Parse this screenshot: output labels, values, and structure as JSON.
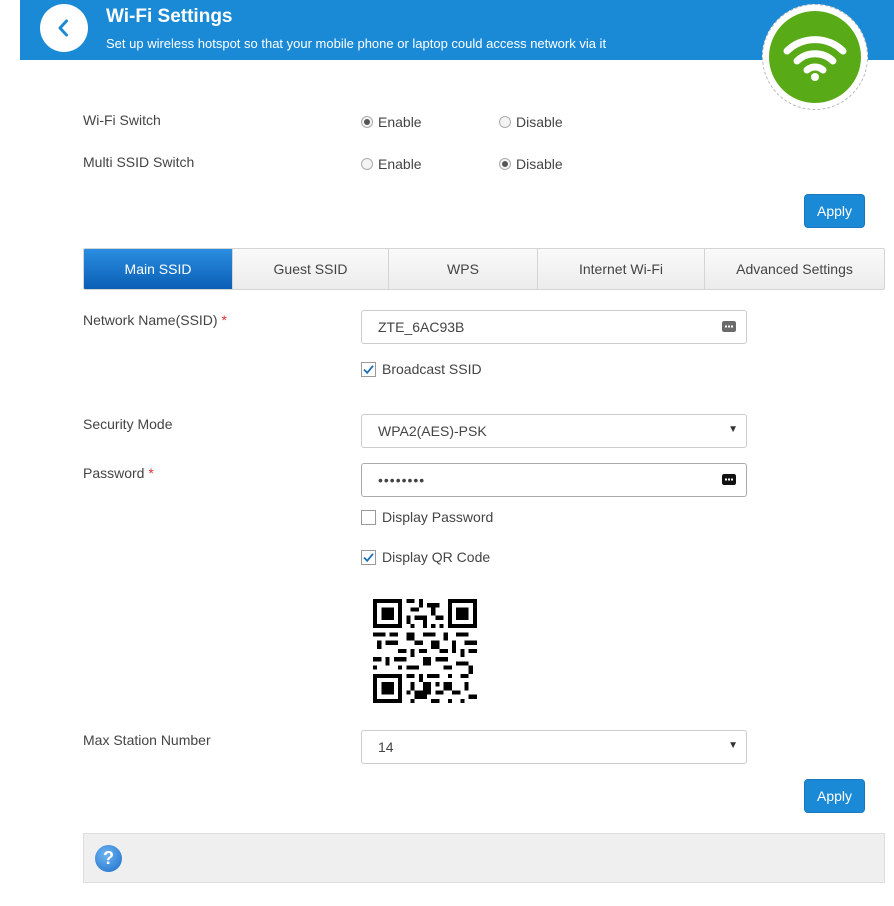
{
  "header": {
    "title": "Wi-Fi Settings",
    "subtitle": "Set up wireless hotspot so that your mobile phone or laptop could access network via it",
    "back_icon": "chevron-left-icon",
    "badge_icon": "wifi-icon"
  },
  "switches": {
    "wifi_switch": {
      "label": "Wi-Fi Switch",
      "enable": "Enable",
      "disable": "Disable",
      "selected": "Enable"
    },
    "multi_ssid_switch": {
      "label": "Multi SSID Switch",
      "enable": "Enable",
      "disable": "Disable",
      "selected": "Disable"
    },
    "apply_label": "Apply"
  },
  "tabs": [
    {
      "label": "Main SSID",
      "active": true
    },
    {
      "label": "Guest SSID",
      "active": false
    },
    {
      "label": "WPS",
      "active": false
    },
    {
      "label": "Internet Wi-Fi",
      "active": false
    },
    {
      "label": "Advanced Settings",
      "active": false
    }
  ],
  "form": {
    "ssid_label": "Network Name(SSID)",
    "required_mark": "*",
    "ssid_value": "ZTE_6AC93B",
    "broadcast_ssid_label": "Broadcast SSID",
    "broadcast_ssid_checked": true,
    "security_mode_label": "Security Mode",
    "security_mode_value": "WPA2(AES)-PSK",
    "password_label": "Password",
    "password_value": "••••••••",
    "display_password_label": "Display Password",
    "display_password_checked": false,
    "display_qr_label": "Display QR Code",
    "display_qr_checked": true,
    "max_station_label": "Max Station Number",
    "max_station_value": "14",
    "apply_label": "Apply"
  },
  "help": {
    "icon": "help-icon",
    "glyph": "?"
  },
  "colors": {
    "header_blue": "#1a8ad6",
    "wifi_green": "#58aa16",
    "tab_active": "#0b5fb5"
  }
}
